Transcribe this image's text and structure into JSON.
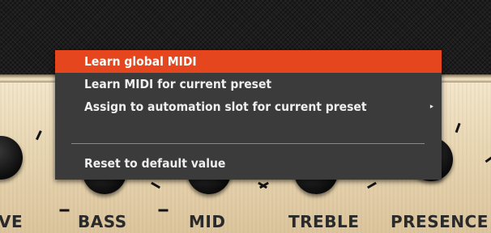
{
  "context_menu": {
    "items": [
      {
        "label": "Learn global MIDI",
        "highlighted": true
      },
      {
        "label": "Learn MIDI for current preset"
      },
      {
        "label": "Assign to automation slot for current preset",
        "submenu_arrow": "▸"
      },
      {
        "label": "Reset to default value"
      }
    ],
    "colors": {
      "background": "#3b3b3b",
      "highlight": "#e5461d",
      "text": "#efefef"
    }
  },
  "amp_panel": {
    "knob_labels": [
      "VE",
      "BASS",
      "MID",
      "TREBLE",
      "PRESENCE"
    ]
  }
}
